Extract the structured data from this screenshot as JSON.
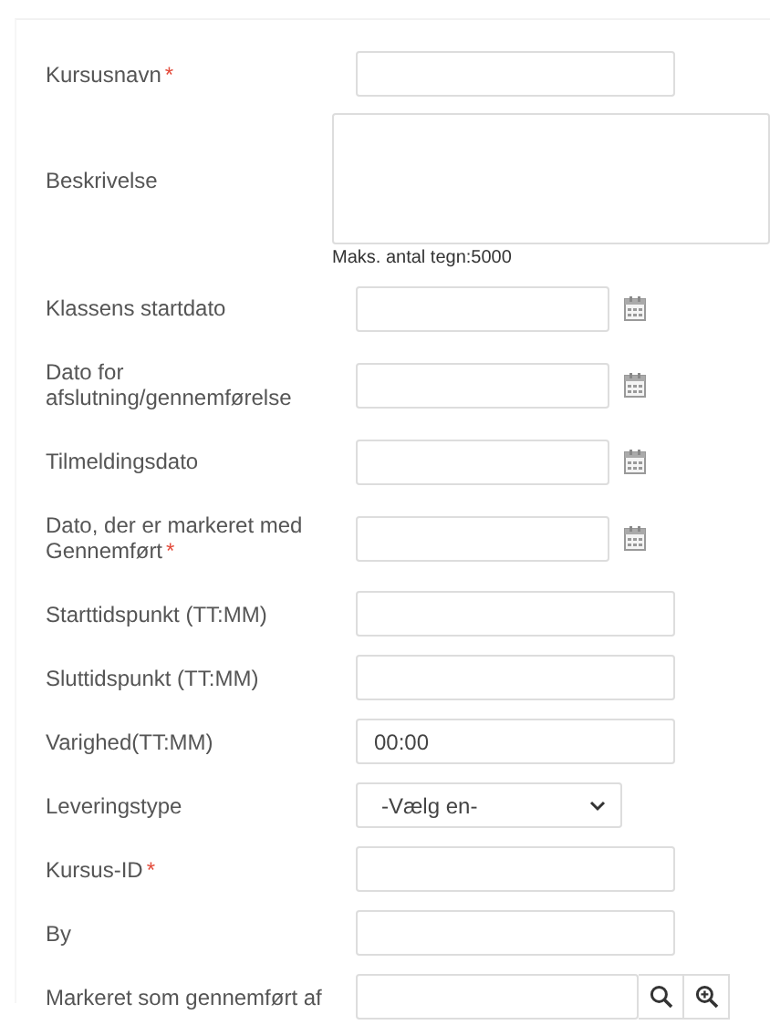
{
  "fields": [
    {
      "kind": "text",
      "label": "Kursusnavn",
      "mark": "*"
    },
    {
      "kind": "textarea",
      "label": "Beskrivelse",
      "hint": "Maks. antal tegn:5000"
    },
    {
      "kind": "date",
      "label": "Klassens startdato"
    },
    {
      "kind": "date",
      "label": "Dato for afslutning/gennemførelse"
    },
    {
      "kind": "date",
      "label": "Tilmeldingsdato"
    },
    {
      "kind": "date",
      "label": "Dato, der er markeret med Gennemført",
      "mark": "*"
    },
    {
      "kind": "text",
      "label": "Starttidspunkt (TT:MM)"
    },
    {
      "kind": "text",
      "label": "Sluttidspunkt (TT:MM)"
    },
    {
      "kind": "text",
      "label": "Varighed(TT:MM)",
      "value": "00:00"
    },
    {
      "kind": "select",
      "label": "Leveringstype",
      "value": "-Vælg en-"
    },
    {
      "kind": "text",
      "label": "Kursus-ID",
      "mark": "*"
    },
    {
      "kind": "text",
      "label": "By"
    },
    {
      "kind": "lookup",
      "label": "Markeret som gennemført af"
    }
  ]
}
